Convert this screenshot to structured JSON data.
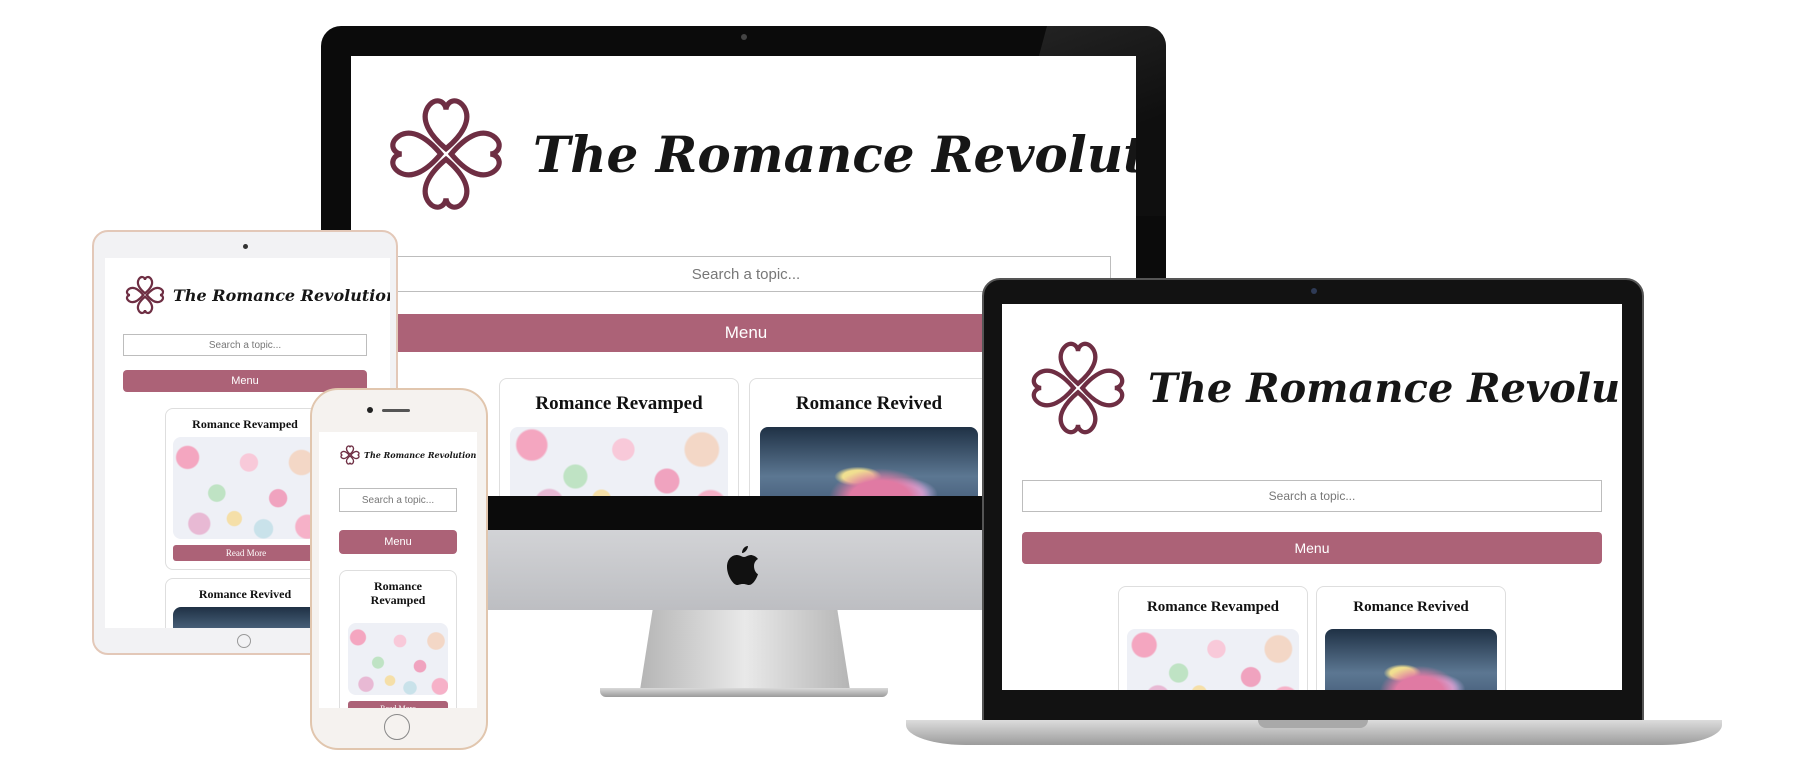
{
  "site": {
    "logo_text": "The Romance Revolution",
    "search_placeholder": "Search a topic...",
    "menu_label": "Menu",
    "read_more_label": "Read More",
    "cards": [
      {
        "title": "Romance Revamped",
        "image": "heart-cookies"
      },
      {
        "title": "Romance Revived",
        "image": "rose-bouquet"
      }
    ]
  },
  "colors": {
    "accent": "#ac6277",
    "logo_heart": "#6e2e43"
  },
  "icons": [
    "heart-clover-logo-icon",
    "apple-logo-icon",
    "camera-icon",
    "home-button-icon"
  ]
}
